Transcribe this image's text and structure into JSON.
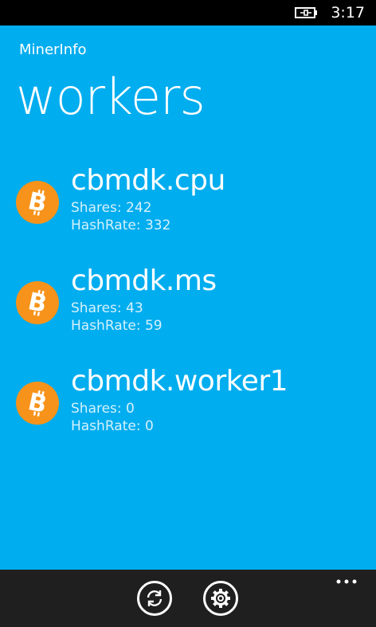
{
  "status_bar": {
    "time": "3:17",
    "battery_icon": "battery-charging-icon"
  },
  "header": {
    "app_title": "MinerInfo",
    "page_title": "workers"
  },
  "workers": [
    {
      "name": "cbmdk.cpu",
      "shares": "Shares: 242",
      "hashrate": "HashRate: 332",
      "icon": "bitcoin-icon"
    },
    {
      "name": "cbmdk.ms",
      "shares": "Shares: 43",
      "hashrate": "HashRate: 59",
      "icon": "bitcoin-icon"
    },
    {
      "name": "cbmdk.worker1",
      "shares": "Shares: 0",
      "hashrate": "HashRate: 0",
      "icon": "bitcoin-icon"
    }
  ],
  "app_bar": {
    "buttons": [
      "refresh-icon",
      "settings-icon"
    ],
    "more_icon": "more-icon"
  },
  "colors": {
    "background": "#00adef",
    "coin": "#f7931a",
    "app_bar": "#1f1f1f"
  }
}
